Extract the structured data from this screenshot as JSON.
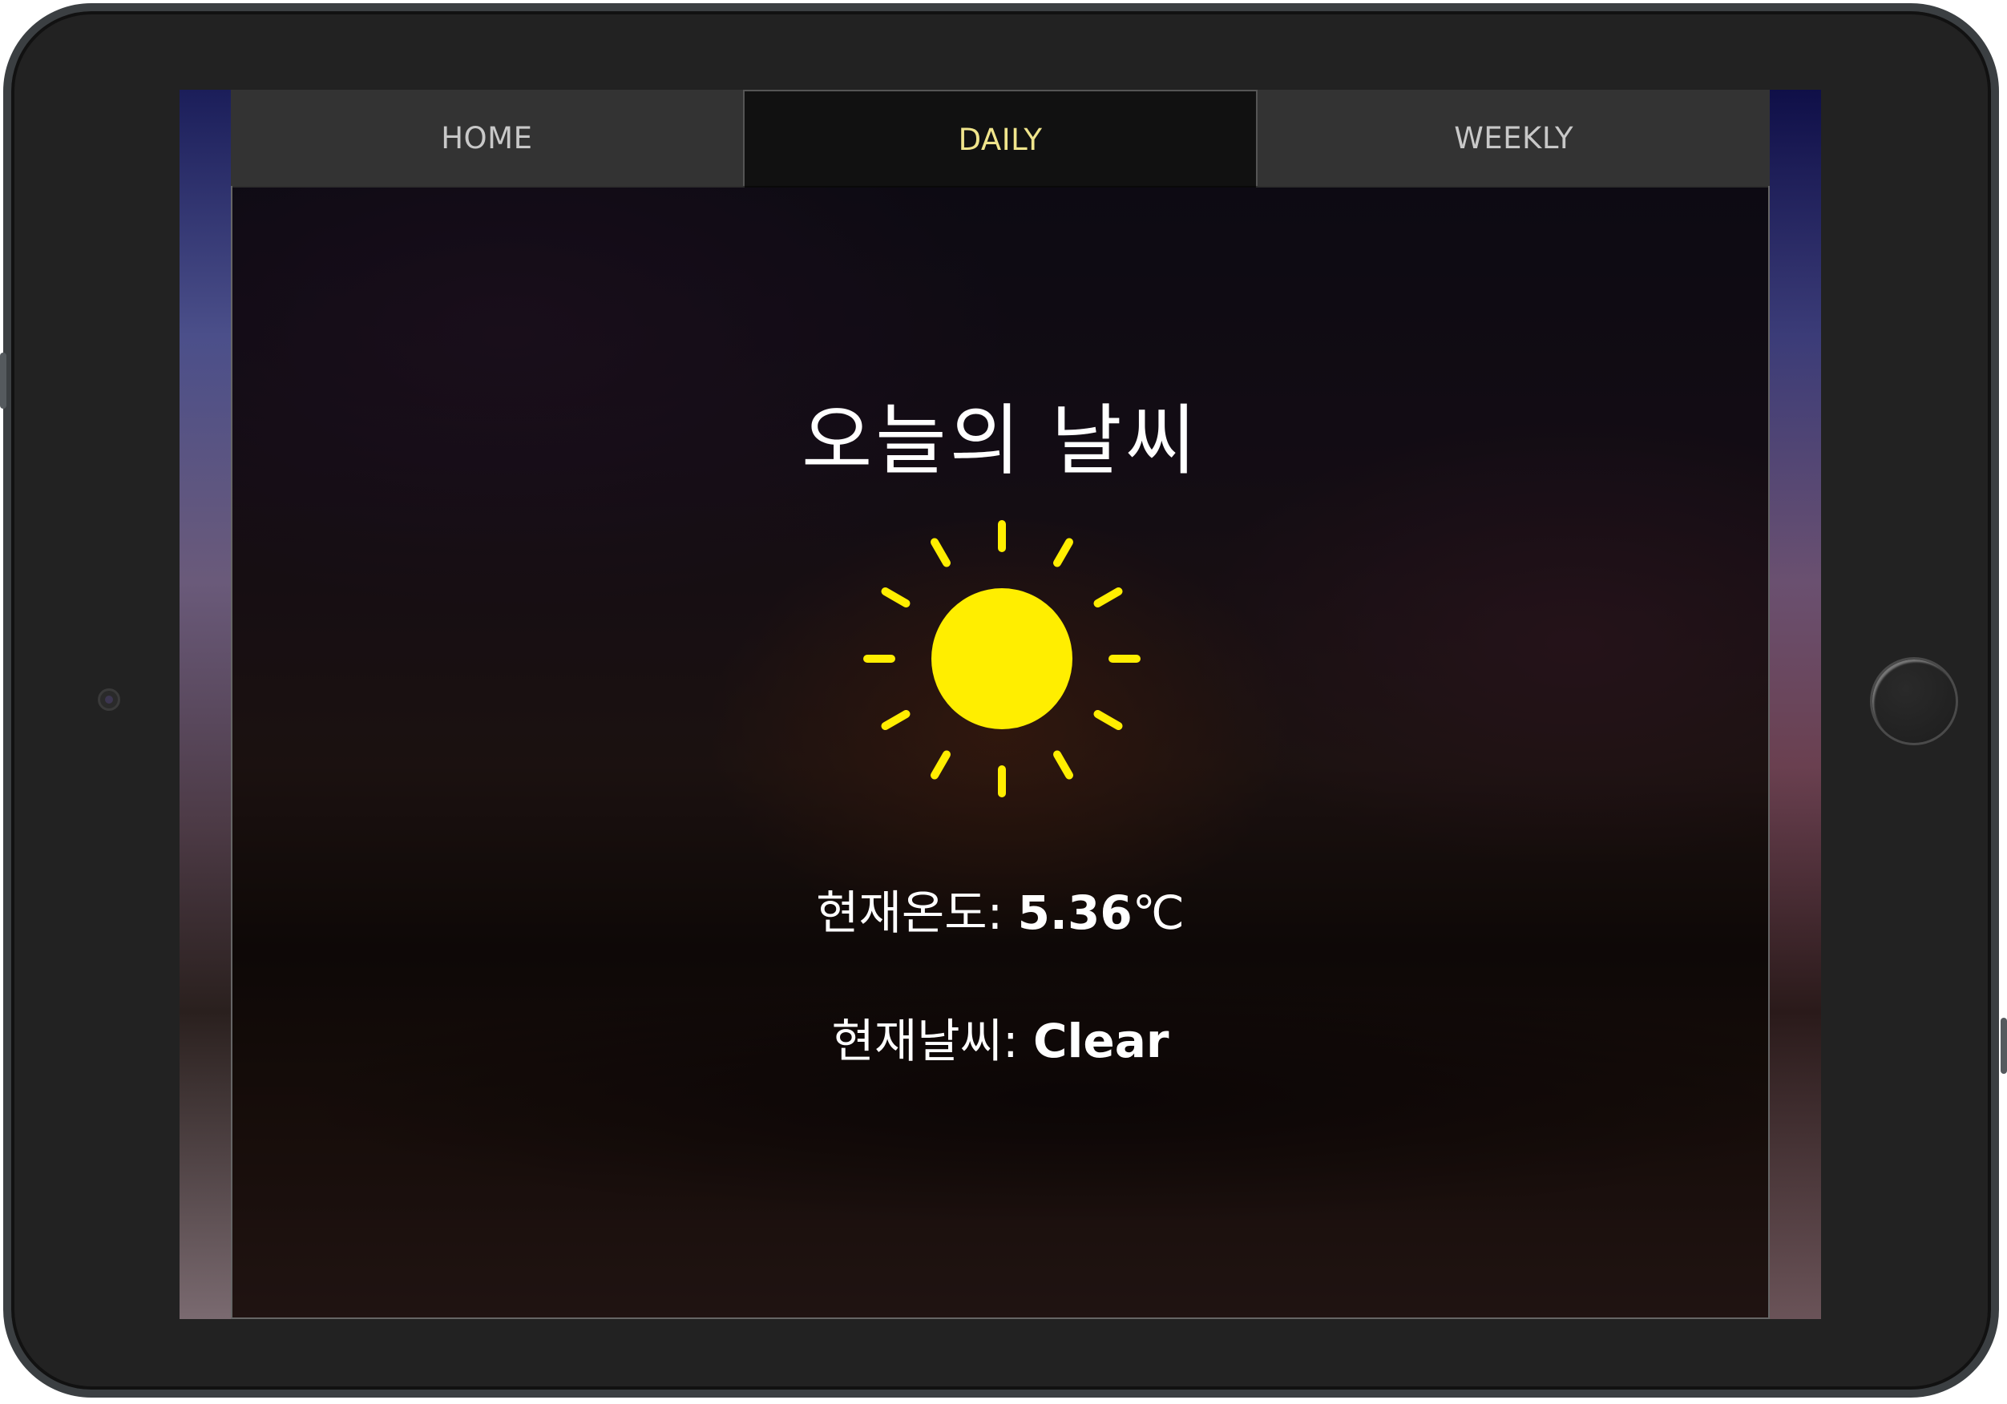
{
  "tabs": [
    {
      "label": "HOME",
      "active": false
    },
    {
      "label": "DAILY",
      "active": true
    },
    {
      "label": "WEEKLY",
      "active": false
    }
  ],
  "daily": {
    "title": "오늘의 날씨",
    "icon": "sun-icon",
    "temperature_label": "현재온도: ",
    "temperature_value": "5.36",
    "temperature_unit": "℃",
    "weather_label": "현재날씨: ",
    "weather_value": "Clear"
  },
  "colors": {
    "active_tab_text": "#f0e58c",
    "tab_text": "#c8c8c8",
    "sun": "#ffee00"
  }
}
